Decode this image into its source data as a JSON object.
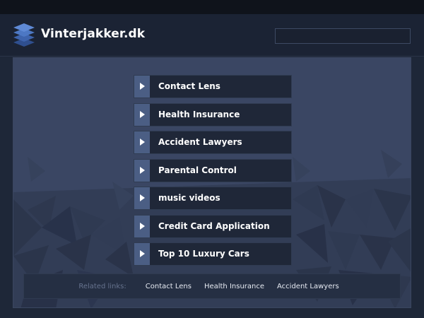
{
  "header": {
    "site_title": "Vinterjakker.dk",
    "search_value": "",
    "search_placeholder": ""
  },
  "links": [
    {
      "label": "Contact Lens"
    },
    {
      "label": "Health Insurance"
    },
    {
      "label": "Accident Lawyers"
    },
    {
      "label": "Parental Control"
    },
    {
      "label": "music videos"
    },
    {
      "label": "Credit Card Application"
    },
    {
      "label": "Top 10 Luxury Cars"
    }
  ],
  "related": {
    "heading": "Related links:",
    "links": [
      {
        "label": "Contact Lens"
      },
      {
        "label": "Health Insurance"
      },
      {
        "label": "Accident Lawyers"
      }
    ]
  },
  "colors": {
    "page_background": "#1e2738",
    "panel_background": "#3a4663",
    "arrow_box": "#4b5e84",
    "link_background": "#1f2738",
    "text": "#ffffff",
    "muted_text": "#66738e"
  },
  "icons": {
    "logo": "stacked-layers-icon",
    "link_arrow": "play-arrow-icon"
  }
}
